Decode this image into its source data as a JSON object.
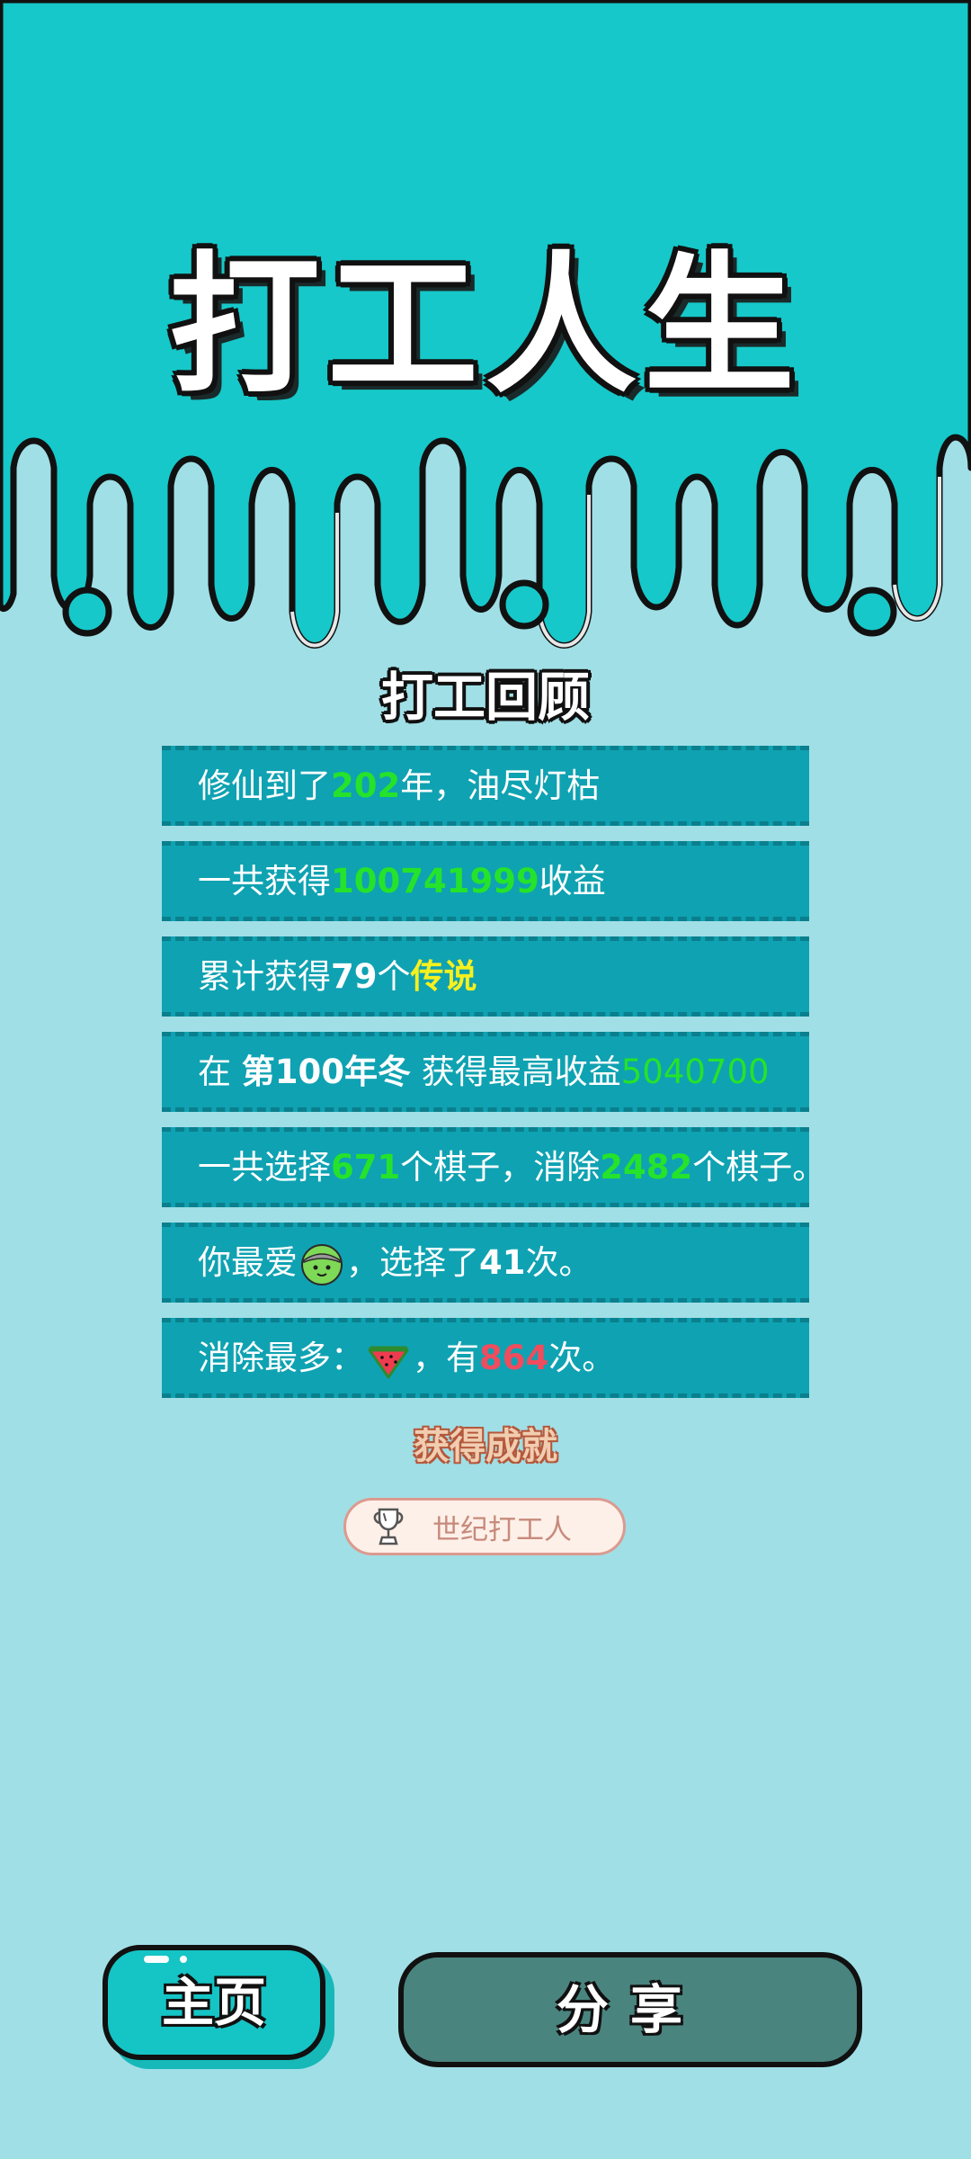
{
  "title": "打工人生",
  "review": {
    "heading": "打工回顾",
    "rows": [
      {
        "parts": [
          "修仙到了",
          "202",
          "年，油尽灯枯"
        ]
      },
      {
        "parts": [
          "一共获得",
          "100741999",
          "收益"
        ]
      },
      {
        "parts": [
          "累计获得",
          "79",
          "个",
          "传说"
        ]
      },
      {
        "parts": [
          "在 ",
          "第100年冬",
          " 获得最高收益",
          "5040700"
        ]
      },
      {
        "parts": [
          "一共选择",
          "671",
          "个棋子，消除",
          "2482",
          "个棋子。"
        ]
      },
      {
        "parts": [
          "你最爱",
          "，选择了",
          "41",
          "次。"
        ],
        "icon": "green-ball-icon"
      },
      {
        "parts": [
          "消除最多：",
          "，有",
          "864",
          "次。"
        ],
        "icon": "watermelon-icon"
      }
    ]
  },
  "achievements": {
    "heading": "获得成就",
    "items": [
      {
        "label": "世纪打工人",
        "icon": "trophy-icon"
      }
    ]
  },
  "buttons": {
    "home": "主页",
    "share": "分享"
  },
  "colors": {
    "top_bg": "#16c8c9",
    "page_bg": "#a0dfe6",
    "row_bg": "#0fa2b2",
    "green": "#25e32a",
    "yellow": "#f6f01e",
    "red": "#ef4c5e"
  }
}
